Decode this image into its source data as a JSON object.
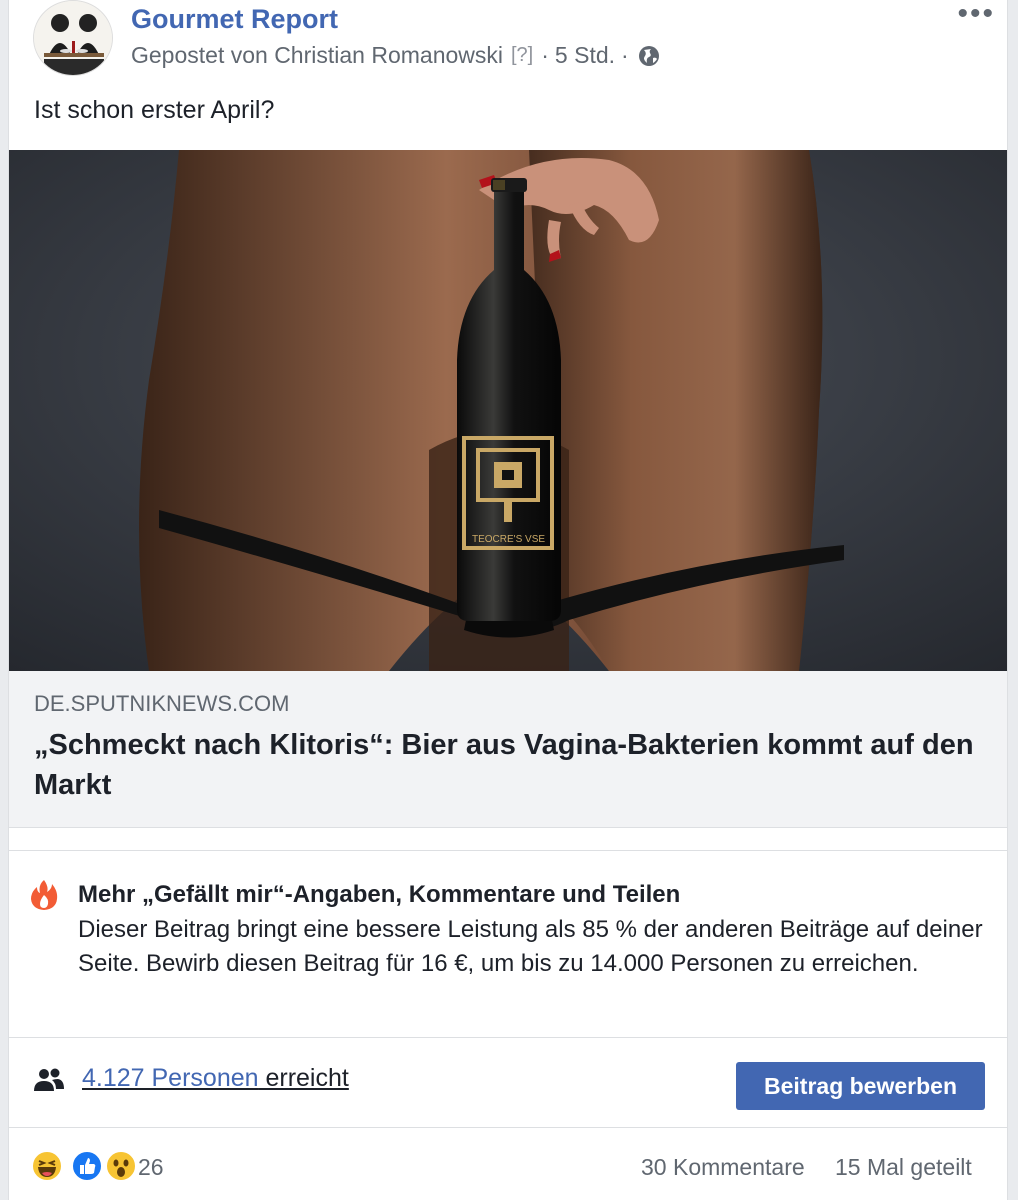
{
  "post": {
    "page_name": "Gourmet Report",
    "posted_by": "Gepostet von Christian Romanowski",
    "help_marker": "[?]",
    "time": "5 Std.",
    "more_icon": "more-options-icon",
    "text": "Ist schon erster April?"
  },
  "link_preview": {
    "domain": "DE.SPUTNIKNEWS.COM",
    "headline": "„Schmeckt nach Klitoris“: Bier aus Vagina-Bakterien kommt auf den Markt"
  },
  "insight": {
    "icon": "fire-icon",
    "title": "Mehr „Gefällt mir“-Angaben, Kommentare und Teilen",
    "body": "Dieser Beitrag bringt eine bessere Leistung als 85 % der anderen Beiträge auf deiner Seite. Bewirb diesen Beitrag für 16 €, um bis zu 14.000 Personen zu erreichen."
  },
  "reach": {
    "count_text": "4.127 Personen",
    "suffix": " erreicht",
    "boost_label": "Beitrag bewerben"
  },
  "reactions": {
    "types": [
      "haha",
      "like",
      "wow"
    ],
    "count": "26",
    "comments": "30 Kommentare",
    "shares": "15 Mal geteilt"
  },
  "colors": {
    "brand_blue": "#4267b2",
    "link_box_bg": "#f2f3f5",
    "secondary_text": "#606770",
    "fire_orange": "#f25c35"
  }
}
